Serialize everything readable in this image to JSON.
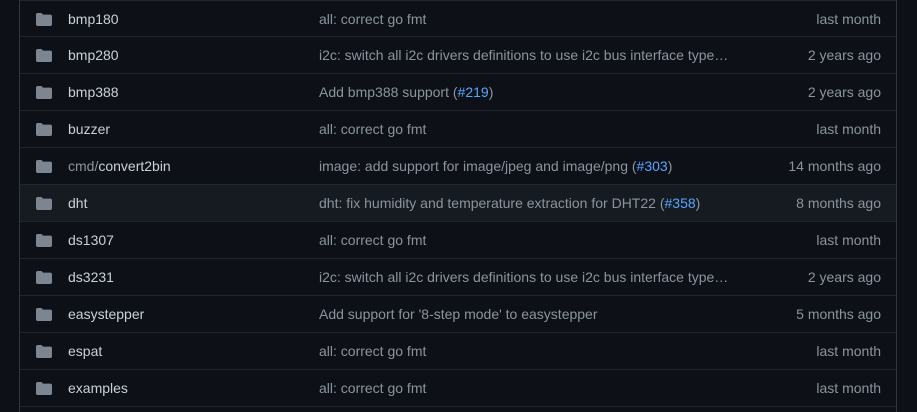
{
  "colors": {
    "background": "#0d1117",
    "row_highlight": "#161b22",
    "folder_icon": "#7d8590",
    "link": "#58a6ff",
    "text_primary": "#c9d1d9",
    "text_muted": "#8b949e"
  },
  "rows": [
    {
      "icon": "folder-icon",
      "name_prefix": "",
      "name": "bmp180",
      "message": "all: correct go fmt",
      "message_pr_open": "",
      "message_pr": "",
      "message_pr_close": "",
      "age": "last month",
      "highlight": false
    },
    {
      "icon": "folder-icon",
      "name_prefix": "",
      "name": "bmp280",
      "message": "i2c: switch all i2c drivers definitions to use i2c bus interface type…",
      "message_pr_open": "",
      "message_pr": "",
      "message_pr_close": "",
      "age": "2 years ago",
      "highlight": false
    },
    {
      "icon": "folder-icon",
      "name_prefix": "",
      "name": "bmp388",
      "message": "Add bmp388 support",
      "message_pr_open": " (",
      "message_pr": "#219",
      "message_pr_close": ")",
      "age": "2 years ago",
      "highlight": false
    },
    {
      "icon": "folder-icon",
      "name_prefix": "",
      "name": "buzzer",
      "message": "all: correct go fmt",
      "message_pr_open": "",
      "message_pr": "",
      "message_pr_close": "",
      "age": "last month",
      "highlight": false
    },
    {
      "icon": "folder-icon",
      "name_prefix": "cmd/",
      "name": "convert2bin",
      "message": "image: add support for image/jpeg and image/png",
      "message_pr_open": " (",
      "message_pr": "#303",
      "message_pr_close": ")",
      "age": "14 months ago",
      "highlight": false
    },
    {
      "icon": "folder-icon",
      "name_prefix": "",
      "name": "dht",
      "message": "dht: fix humidity and temperature extraction for DHT22",
      "message_pr_open": " (",
      "message_pr": "#358",
      "message_pr_close": ")",
      "age": "8 months ago",
      "highlight": true
    },
    {
      "icon": "folder-icon",
      "name_prefix": "",
      "name": "ds1307",
      "message": "all: correct go fmt",
      "message_pr_open": "",
      "message_pr": "",
      "message_pr_close": "",
      "age": "last month",
      "highlight": false
    },
    {
      "icon": "folder-icon",
      "name_prefix": "",
      "name": "ds3231",
      "message": "i2c: switch all i2c drivers definitions to use i2c bus interface type…",
      "message_pr_open": "",
      "message_pr": "",
      "message_pr_close": "",
      "age": "2 years ago",
      "highlight": false
    },
    {
      "icon": "folder-icon",
      "name_prefix": "",
      "name": "easystepper",
      "message": "Add support for '8-step mode' to easystepper",
      "message_pr_open": "",
      "message_pr": "",
      "message_pr_close": "",
      "age": "5 months ago",
      "highlight": false
    },
    {
      "icon": "folder-icon",
      "name_prefix": "",
      "name": "espat",
      "message": "all: correct go fmt",
      "message_pr_open": "",
      "message_pr": "",
      "message_pr_close": "",
      "age": "last month",
      "highlight": false
    },
    {
      "icon": "folder-icon",
      "name_prefix": "",
      "name": "examples",
      "message": "all: correct go fmt",
      "message_pr_open": "",
      "message_pr": "",
      "message_pr_close": "",
      "age": "last month",
      "highlight": false
    }
  ]
}
